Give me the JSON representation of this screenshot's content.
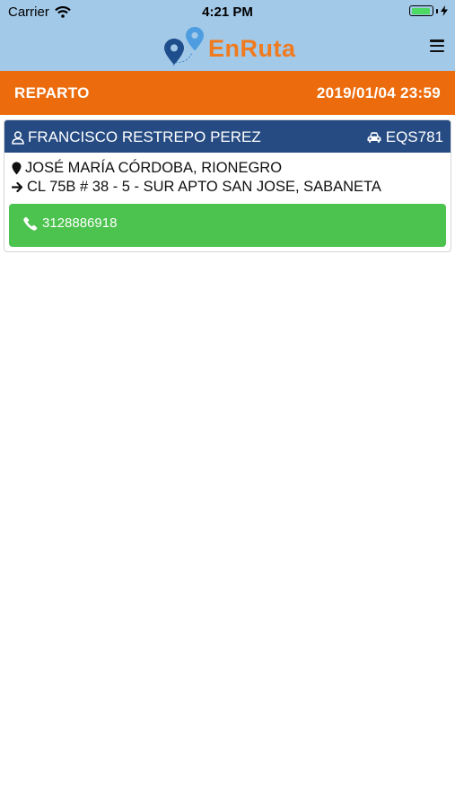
{
  "status_bar": {
    "carrier": "Carrier",
    "time": "4:21 PM",
    "battery_level": 0.95
  },
  "header": {
    "logo_text": "EnRuta",
    "brand_color": "#f07a1e"
  },
  "section": {
    "title": "REPARTO",
    "datetime": "2019/01/04 23:59"
  },
  "order": {
    "customer_name": "FRANCISCO RESTREPO PEREZ",
    "plate": "EQS781",
    "origin": "JOSÉ MARÍA CÓRDOBA, RIONEGRO",
    "destination": "CL 75B # 38 - 5 - SUR APTO SAN JOSE, SABANETA",
    "phone": "3128886918"
  },
  "colors": {
    "header_bg": "#a3c9e8",
    "section_bg": "#ec6c0d",
    "card_header_bg": "#264b83",
    "phone_button_bg": "#4cc24f"
  }
}
